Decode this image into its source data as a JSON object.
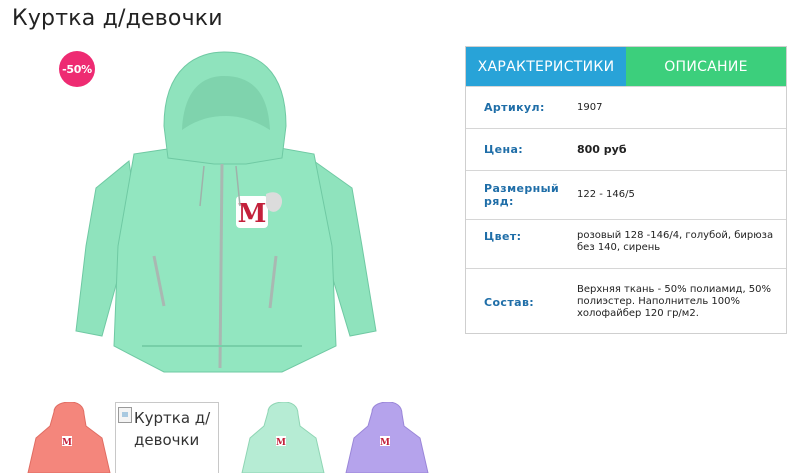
{
  "product": {
    "title": "Куртка д/девочки",
    "discount_badge": "-50%",
    "main_image_color": "#8fe3bd",
    "thumbnails": [
      {
        "kind": "jacket",
        "color": "#f4867c",
        "visible": true
      },
      {
        "kind": "broken",
        "alt": "Куртка д/девочки"
      },
      {
        "kind": "jacket",
        "color": "#9ee6c6",
        "visible": true
      },
      {
        "kind": "jacket",
        "color": "#b5a3ec",
        "visible": true
      }
    ]
  },
  "tabs": {
    "specs": "ХАРАКТЕРИСТИКИ",
    "description": "ОПИСАНИЕ",
    "active_color": "#28a3d8",
    "inactive_color": "#3ccf7c"
  },
  "specs": {
    "sku": {
      "label": "Артикул:",
      "value": "1907"
    },
    "price": {
      "label": "Цена:",
      "value": "800 руб"
    },
    "size": {
      "label": "Размерный ряд:",
      "value": "122 - 146/5"
    },
    "color": {
      "label": "Цвет:",
      "value": "розовый 128 -146/4, голубой, бирюза без 140, сирень"
    },
    "composition": {
      "label": "Состав:",
      "value": "Верхняя ткань - 50% полиамид, 50% полиэстер. Наполнитель 100% холофайбер 120 гр/м2."
    }
  },
  "colors": {
    "label": "#1f6ea8",
    "badge": "#ee2b72"
  }
}
